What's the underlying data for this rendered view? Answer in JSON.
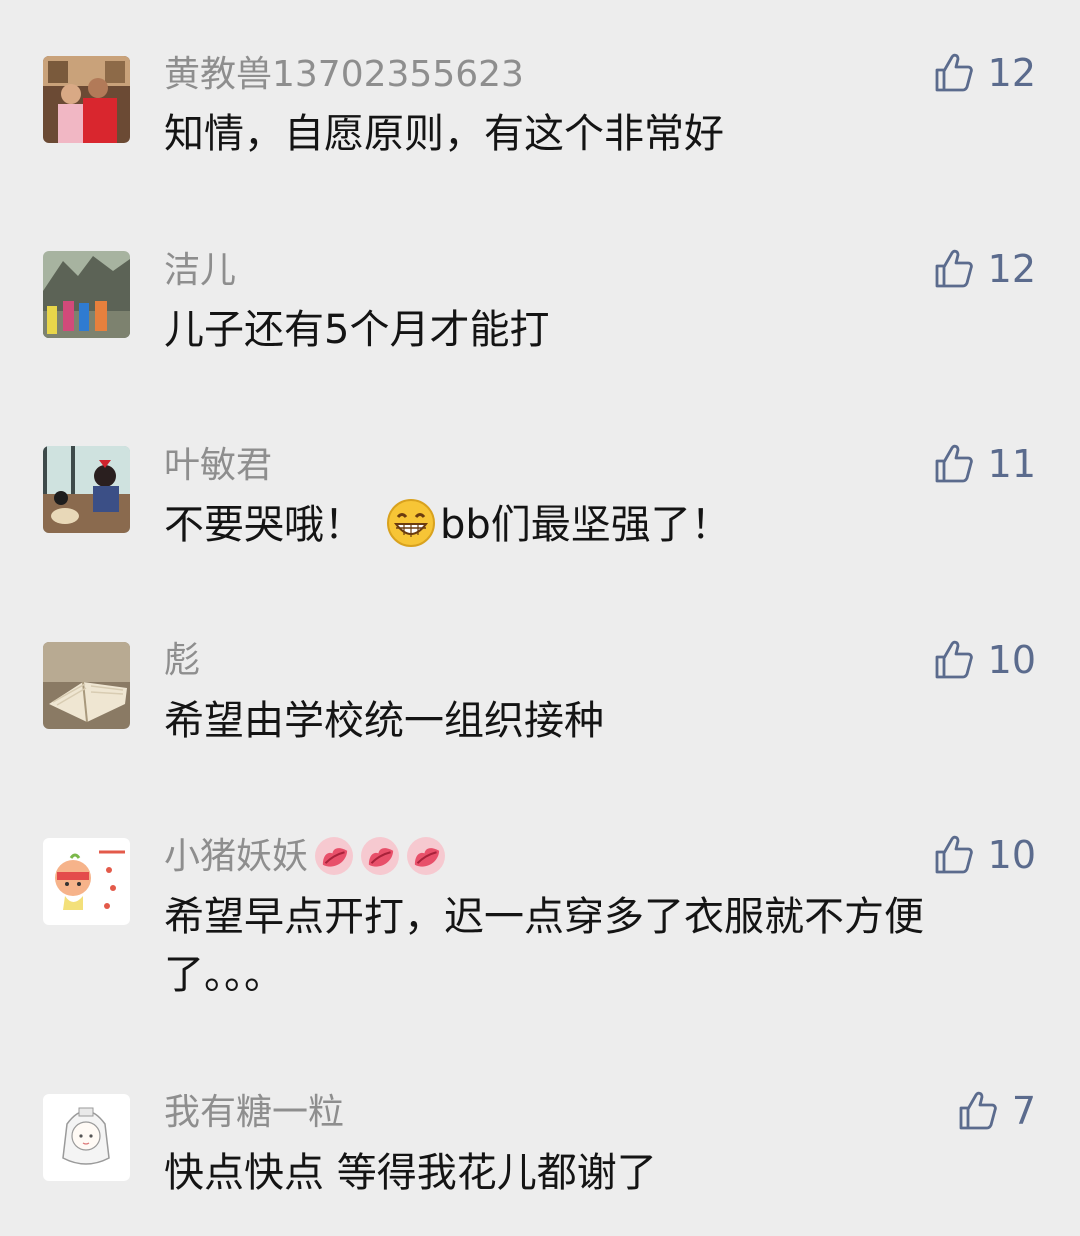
{
  "comments": [
    {
      "name": "黄教兽13702355623",
      "text": "知情，自愿原则，有这个非常好",
      "likes": "12"
    },
    {
      "name": "洁儿",
      "text": "儿子还有5个月才能打",
      "likes": "12"
    },
    {
      "name": "叶敏君",
      "text_before_emoji": "不要哭哦！",
      "text_after_emoji": "bb们最坚强了！",
      "emoji": "grinning-face",
      "likes": "11"
    },
    {
      "name": "彪",
      "text": "希望由学校统一组织接种",
      "likes": "10"
    },
    {
      "name": "小猪妖妖",
      "name_emoji": "kiss-lips",
      "text": "希望早点开打，迟一点穿多了衣服就不方便了。。。",
      "likes": "10"
    },
    {
      "name": "我有糖一粒",
      "text": "快点快点 等得我花儿都谢了",
      "likes": "7"
    }
  ],
  "icons": {
    "like": "thumbs-up-icon"
  },
  "colors": {
    "like": "#5b6b8d",
    "name": "#8e8e8e",
    "text": "#141414",
    "background": "#ededed"
  }
}
